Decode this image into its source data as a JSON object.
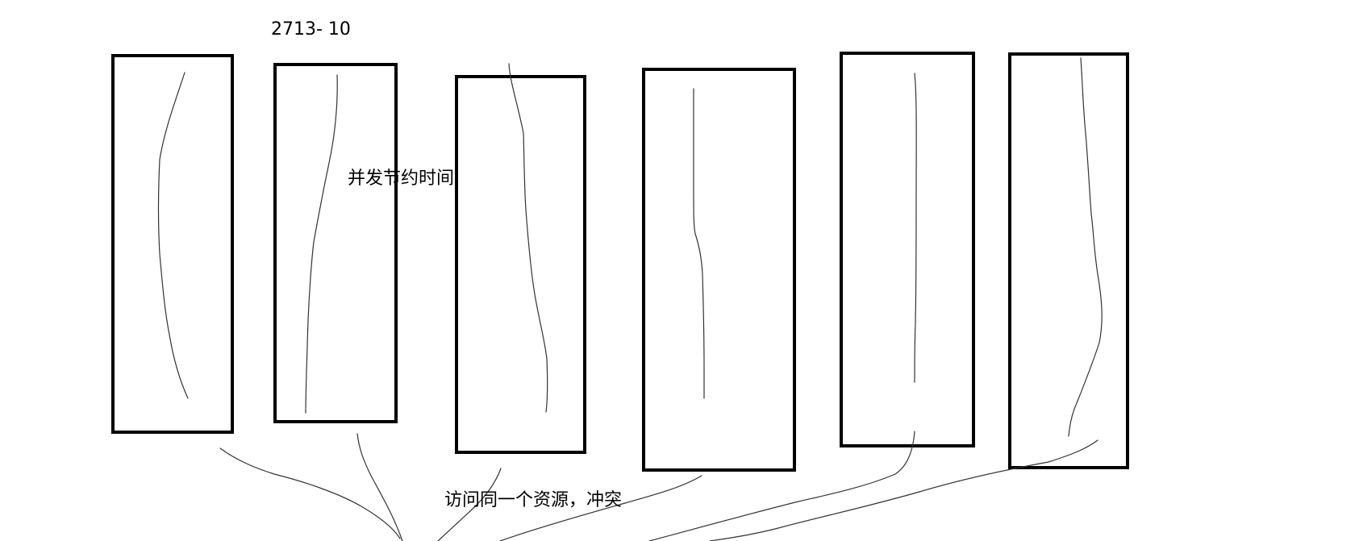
{
  "labels": {
    "header": "2713-  10",
    "concurrency": "并发节约时间",
    "conflict": "访问同一个资源，冲突"
  },
  "colors": {
    "ink": "#000000",
    "background": "#ffffff"
  },
  "diagram": {
    "boxes": [
      "box-1",
      "box-2",
      "box-3",
      "box-4",
      "box-5",
      "box-6"
    ],
    "connectors": [
      "connector-1",
      "connector-2",
      "connector-3",
      "connector-4",
      "connector-5",
      "connector-6"
    ]
  }
}
